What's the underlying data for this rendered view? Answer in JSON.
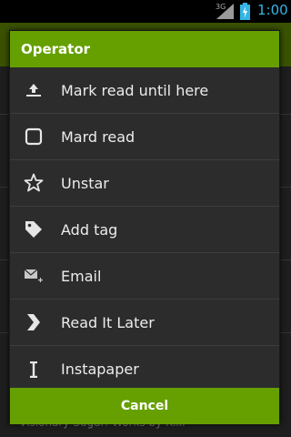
{
  "status_bar": {
    "network": "3G",
    "time": "1:00"
  },
  "background": {
    "footer_text": "'Visionary Sugar: Works by Kiki"
  },
  "dialog": {
    "title": "Operator",
    "items": [
      {
        "label": "Mark read until here",
        "icon": "upload-icon"
      },
      {
        "label": "Mard read",
        "icon": "checkbox-icon"
      },
      {
        "label": "Unstar",
        "icon": "star-outline-icon"
      },
      {
        "label": "Add tag",
        "icon": "tag-icon"
      },
      {
        "label": "Email",
        "icon": "email-icon"
      },
      {
        "label": "Read It Later",
        "icon": "read-it-later-icon"
      },
      {
        "label": "Instapaper",
        "icon": "instapaper-icon"
      }
    ],
    "cancel_label": "Cancel"
  },
  "colors": {
    "accent_green": "#66a000",
    "dialog_bg": "#2c2c2c",
    "clock_blue": "#33b5e5"
  }
}
